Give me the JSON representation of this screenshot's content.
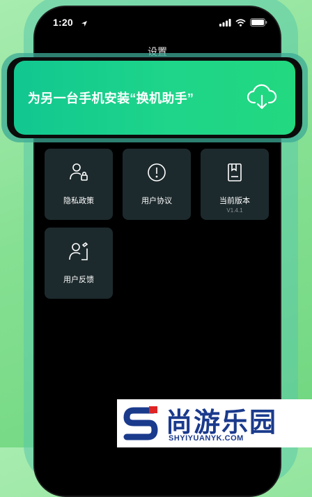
{
  "status_bar": {
    "time": "1:20",
    "icons": [
      "location-arrow-icon",
      "signal-icon",
      "wifi-icon",
      "battery-icon"
    ]
  },
  "nav": {
    "title": "设置"
  },
  "banner": {
    "text": "为另一台手机安装“换机助手”",
    "icon": "cloud-download-icon"
  },
  "tiles": [
    {
      "label": "隐私政策",
      "icon": "user-lock-icon"
    },
    {
      "label": "用户协议",
      "icon": "info-circle-icon"
    },
    {
      "label": "当前版本",
      "sub": "V1.4.1",
      "icon": "book-icon"
    },
    {
      "label": "用户反馈",
      "icon": "feedback-person-icon"
    }
  ],
  "watermark": {
    "name": "尚游乐园",
    "url": "SHYIYUANYK.COM"
  },
  "colors": {
    "background": "#86e093",
    "banner": "#1ed58a",
    "tile": "#1d2a2d",
    "watermark_text": "#1a3a8c",
    "watermark_accent": "#e02424"
  }
}
